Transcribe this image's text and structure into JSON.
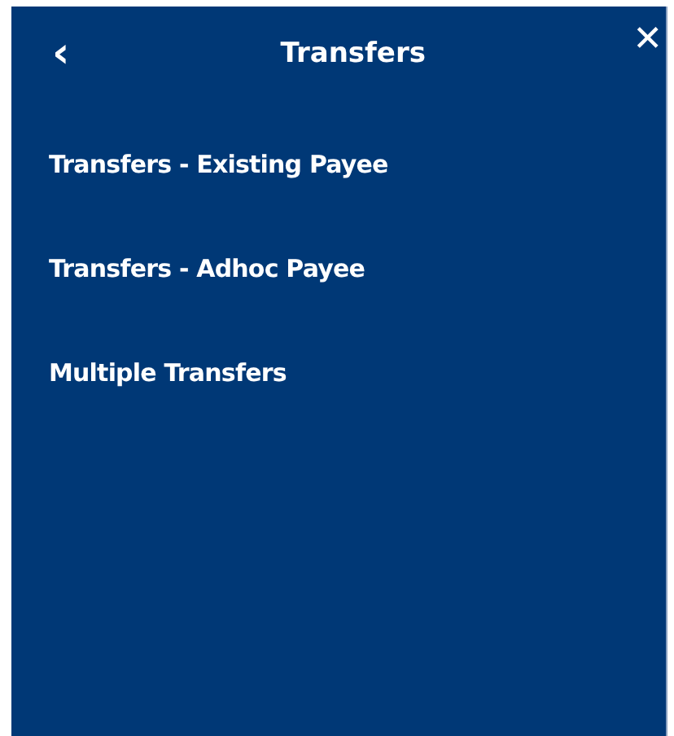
{
  "header": {
    "back": "‹",
    "title": "Transfers",
    "close": "✕"
  },
  "menu_items": [
    {
      "label": "Transfers - Existing Payee"
    },
    {
      "label": "Transfers - Adhoc Payee"
    },
    {
      "label": "Multiple Transfers"
    }
  ]
}
